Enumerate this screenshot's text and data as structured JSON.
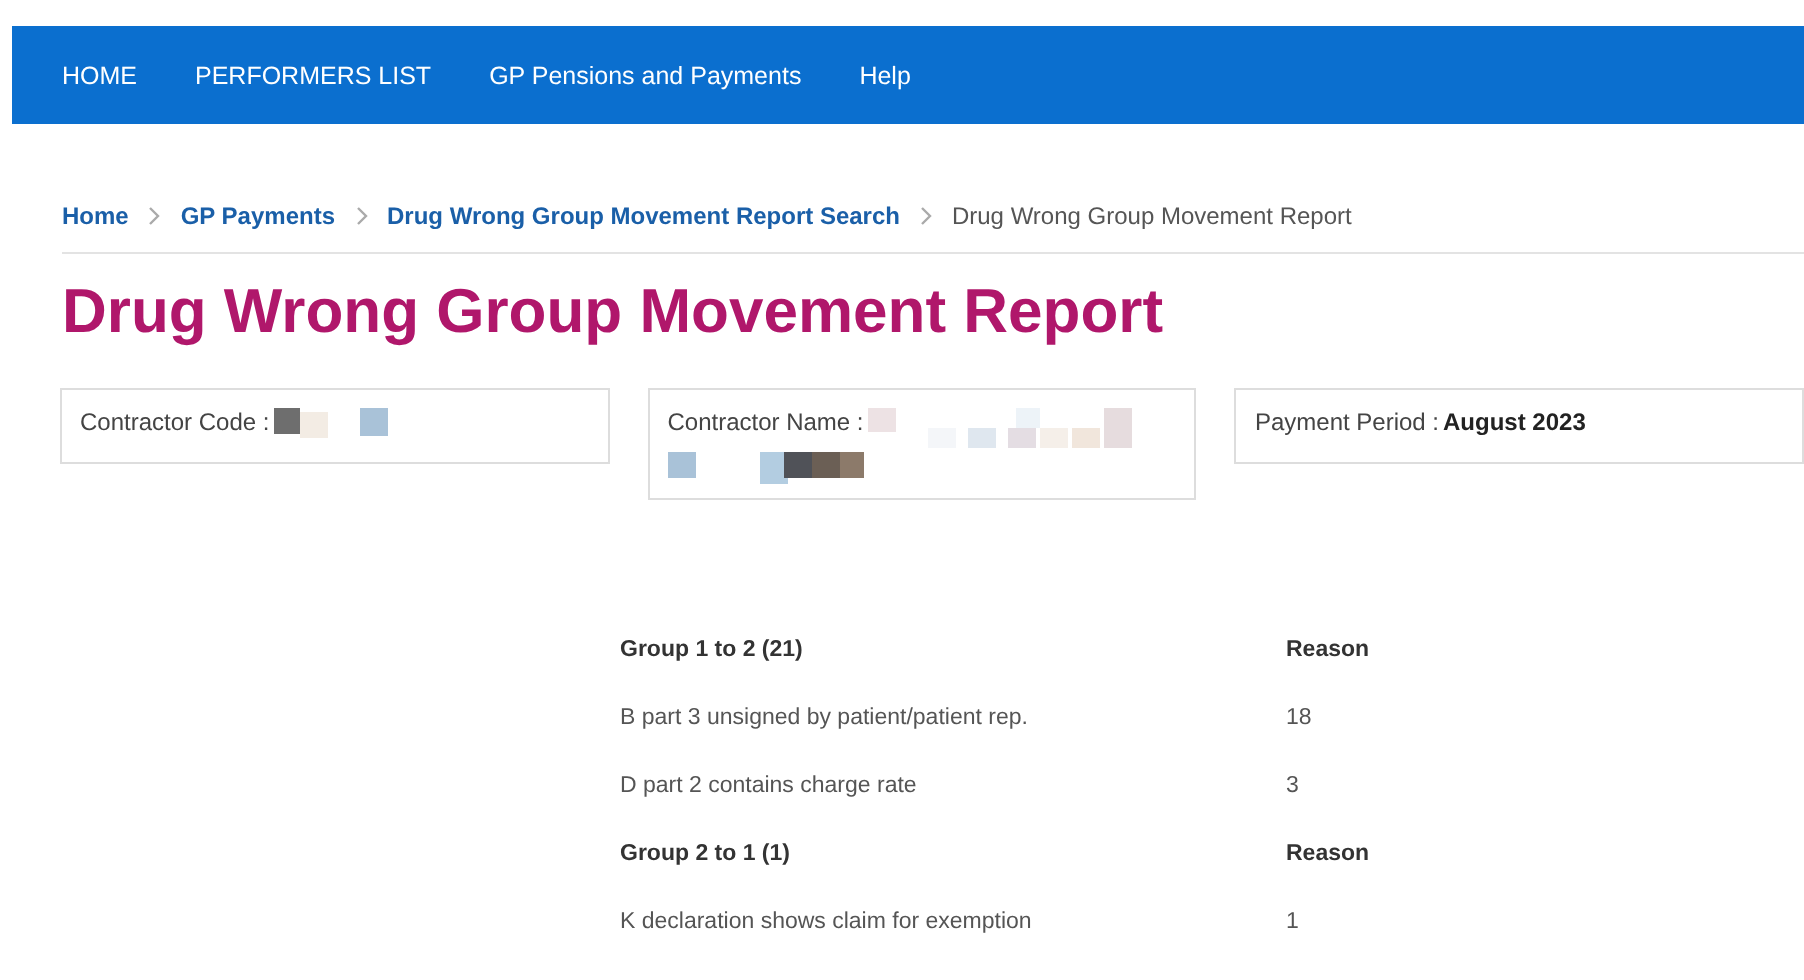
{
  "nav": {
    "items": [
      {
        "label": "HOME"
      },
      {
        "label": "PERFORMERS LIST"
      },
      {
        "label": "GP Pensions and Payments"
      },
      {
        "label": "Help"
      }
    ]
  },
  "breadcrumb": [
    {
      "label": "Home",
      "kind": "link"
    },
    {
      "label": "GP Payments",
      "kind": "link"
    },
    {
      "label": "Drug Wrong Group Movement Report Search",
      "kind": "link"
    },
    {
      "label": "Drug Wrong Group Movement Report",
      "kind": "current"
    }
  ],
  "title": "Drug Wrong Group Movement Report",
  "fields": [
    {
      "label": "Contractor Code :",
      "kind": "redacted"
    },
    {
      "label": "Contractor Name :",
      "kind": "redacted-long"
    },
    {
      "label": "Payment Period :",
      "kind": "text",
      "value": "August 2023"
    }
  ],
  "table": {
    "groups": [
      {
        "heading": "Group 1 to 2 (21)",
        "column_2": "Reason",
        "rows": [
          {
            "reason": "B part 3 unsigned by patient/patient rep.",
            "count": "18"
          },
          {
            "reason": "D part 2 contains charge rate",
            "count": "3"
          }
        ]
      },
      {
        "heading": "Group 2 to 1 (1)",
        "column_2": "Reason",
        "rows": [
          {
            "reason": "K declaration shows claim for exemption",
            "count": "1"
          }
        ]
      }
    ]
  }
}
